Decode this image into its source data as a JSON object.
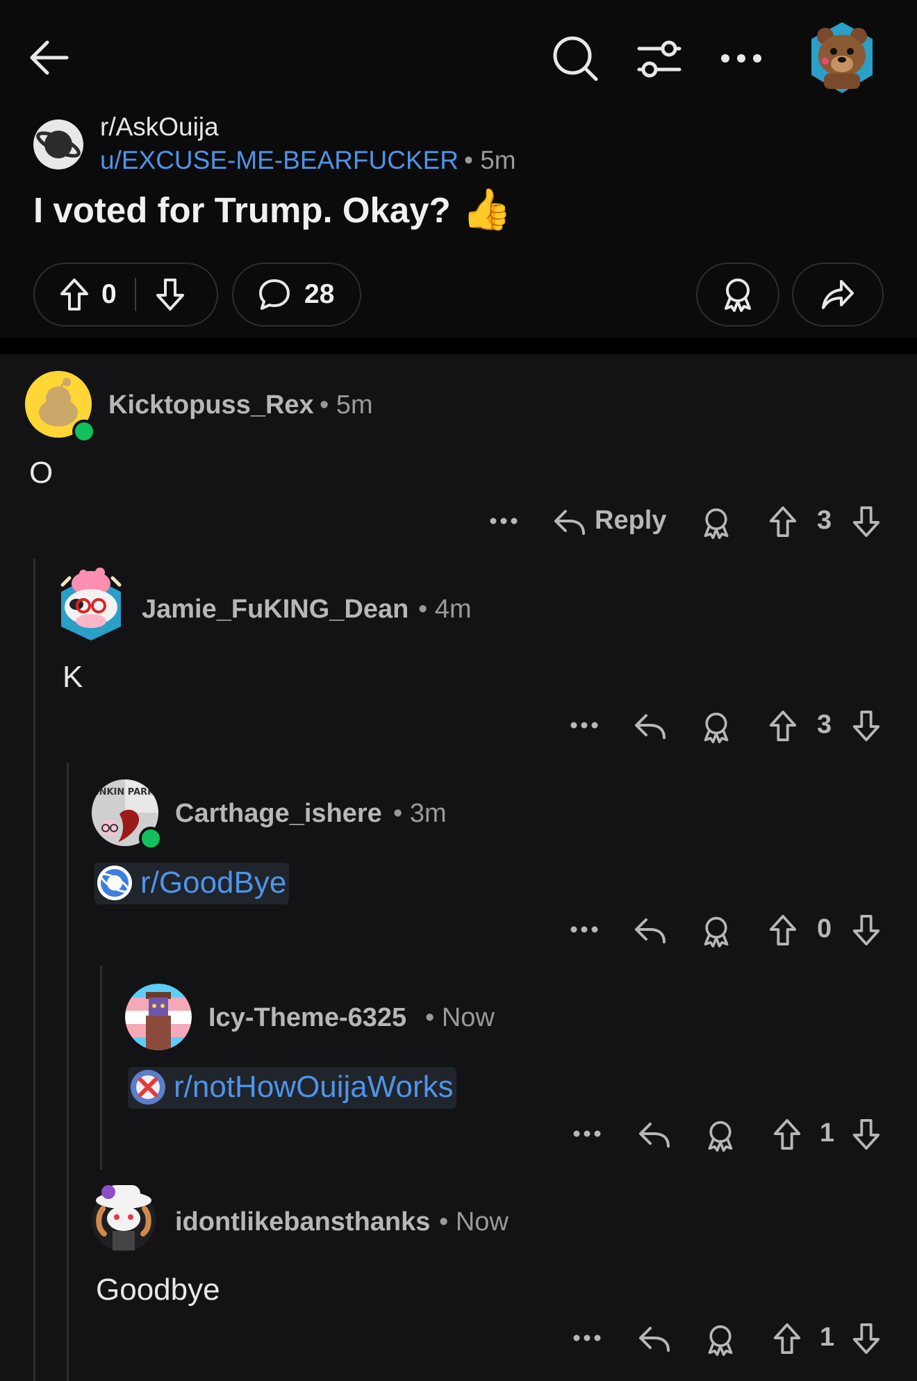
{
  "header": {
    "back_icon": "arrow-left-icon",
    "search_icon": "search-icon",
    "filter_icon": "sliders-icon",
    "more_icon": "ellipsis-icon"
  },
  "post": {
    "subreddit": "r/AskOuija",
    "author": "u/EXCUSE-ME-BEARFUCKER",
    "time": "• 5m",
    "title": "I voted for Trump. Okay?",
    "title_emoji": "👍",
    "votes": "0",
    "comments": "28"
  },
  "comments": [
    {
      "user": "Kicktopuss_Rex",
      "time": "• 5m",
      "body": "O",
      "votes": "3",
      "reply_label": "Reply"
    },
    {
      "user": "Jamie_FuKING_Dean",
      "time": "• 4m",
      "body": "K",
      "votes": "3"
    },
    {
      "user": "Carthage_ishere",
      "time": "• 3m",
      "link": "r/GoodBye",
      "votes": "0",
      "avatar_text": "INKIN PARK"
    },
    {
      "user": "Icy-Theme-6325",
      "time": "• Now",
      "link": "r/notHowOuijaWorks",
      "votes": "1"
    },
    {
      "user": "idontlikebansthanks",
      "time": "• Now",
      "body": "Goodbye",
      "votes": "1"
    }
  ],
  "colors": {
    "background": "#0b0b0c",
    "link": "#4f94e8",
    "online": "#12c05c"
  }
}
